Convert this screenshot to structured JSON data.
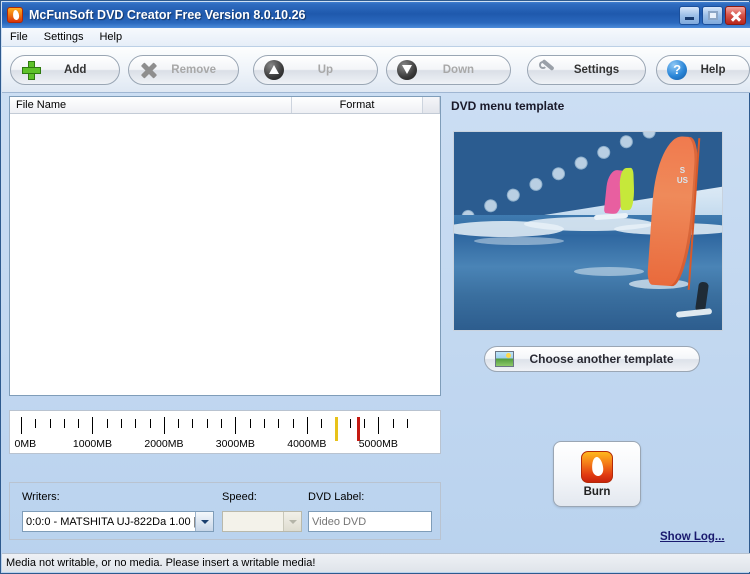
{
  "window": {
    "title": "McFunSoft DVD Creator Free Version 8.0.10.26",
    "app_icon": "flame-icon",
    "controls": {
      "minimize": "minimize-button",
      "maximize": "maximize-button",
      "close": "close-button"
    }
  },
  "menubar": {
    "items": [
      {
        "label": "File"
      },
      {
        "label": "Settings"
      },
      {
        "label": "Help"
      }
    ]
  },
  "toolbar": {
    "buttons": [
      {
        "label": "Add",
        "icon": "plus-icon",
        "enabled": true
      },
      {
        "label": "Remove",
        "icon": "x-icon",
        "enabled": false
      },
      {
        "label": "Up",
        "icon": "arrow-up-icon",
        "enabled": false
      },
      {
        "label": "Down",
        "icon": "arrow-down-icon",
        "enabled": false
      },
      {
        "label": "Settings",
        "icon": "wrench-icon",
        "enabled": true
      },
      {
        "label": "Help",
        "icon": "question-mark-icon",
        "enabled": true
      }
    ]
  },
  "file_list": {
    "columns": [
      {
        "label": "File Name"
      },
      {
        "label": "Format"
      }
    ],
    "rows": []
  },
  "capacity_ruler": {
    "labels": [
      "0MB",
      "1000MB",
      "2000MB",
      "3000MB",
      "4000MB",
      "5000MB"
    ],
    "major_values": [
      0,
      1000,
      2000,
      3000,
      4000,
      5000
    ],
    "minor_step_mb": 200,
    "max_mb": 5500,
    "markers": [
      {
        "name": "cd-capacity-marker",
        "value_mb": 4400,
        "color": "#e8c21a"
      },
      {
        "name": "dvd-capacity-marker",
        "value_mb": 4700,
        "color": "#c41a12"
      }
    ]
  },
  "burner_panel": {
    "writers_label": "Writers:",
    "writers_value": "0:0:0 - MATSHITA UJ-822Da 1.00 [",
    "speed_label": "Speed:",
    "speed_value": "",
    "speed_enabled": false,
    "dvd_label_label": "DVD Label:",
    "dvd_label_placeholder": "Video DVD",
    "dvd_label_value": ""
  },
  "template_panel": {
    "title": "DVD menu template",
    "preview_alt": "windsurfing-template-preview",
    "choose_button": "Choose another template",
    "choose_icon": "picture-icon"
  },
  "burn": {
    "label": "Burn",
    "icon": "flame-icon"
  },
  "show_log": {
    "label": "Show Log..."
  },
  "statusbar": {
    "message": "Media not writable, or no media. Please insert a writable media!"
  },
  "colors": {
    "titlebar_blue": "#1f59ad",
    "accent_orange": "#f5811a",
    "accent_red": "#c8230c",
    "link_navy": "#1a1a6e",
    "marker_yellow": "#e8c21a",
    "marker_red": "#c41a12"
  }
}
